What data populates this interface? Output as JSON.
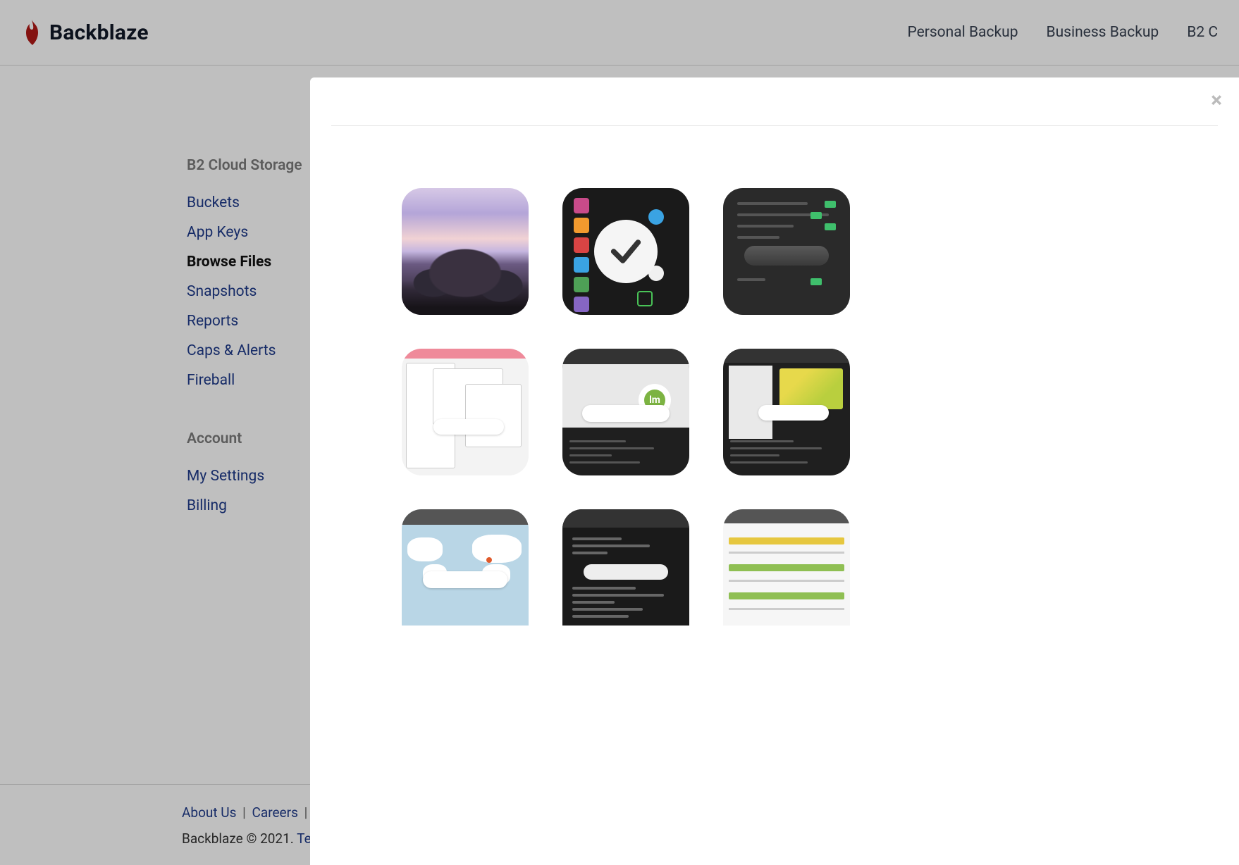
{
  "brand": {
    "name": "Backblaze"
  },
  "nav": {
    "items": [
      {
        "label": "Personal Backup"
      },
      {
        "label": "Business Backup"
      },
      {
        "label": "B2 C"
      }
    ]
  },
  "sidebar": {
    "section1_title": "B2 Cloud Storage",
    "section1_items": [
      {
        "label": "Buckets",
        "active": false
      },
      {
        "label": "App Keys",
        "active": false
      },
      {
        "label": "Browse Files",
        "active": true
      },
      {
        "label": "Snapshots",
        "active": false
      },
      {
        "label": "Reports",
        "active": false
      },
      {
        "label": "Caps & Alerts",
        "active": false
      },
      {
        "label": "Fireball",
        "active": false
      }
    ],
    "section2_title": "Account",
    "section2_items": [
      {
        "label": "My Settings"
      },
      {
        "label": "Billing"
      }
    ]
  },
  "footer": {
    "about": "About Us",
    "careers": "Careers",
    "sep": "|",
    "copyright": "Backblaze © 2021.",
    "terms_prefix": "Ter"
  },
  "modal": {
    "close_glyph": "×",
    "thumbs": [
      {
        "name": "mountain-photo"
      },
      {
        "name": "settings-check"
      },
      {
        "name": "dark-form"
      },
      {
        "name": "windows-collage"
      },
      {
        "name": "terminal-lm"
      },
      {
        "name": "photo-panel"
      },
      {
        "name": "world-map"
      },
      {
        "name": "dark-code"
      },
      {
        "name": "light-report"
      }
    ],
    "lm_text": "lm"
  }
}
